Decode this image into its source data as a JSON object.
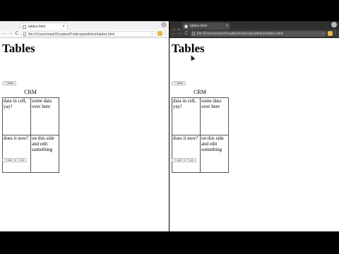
{
  "browsers": [
    {
      "theme": "light",
      "tab_title": "tables.html",
      "url": "file:///Users/mark/Dropbox/Public/gwuttl/test/tables.html",
      "heading": "Tables",
      "table_button_label": "+ table",
      "caption": "CRM",
      "rows": [
        [
          "data in cell, yay!",
          "some data over here"
        ],
        [
          "does it now?",
          "on this side and edit something"
        ]
      ],
      "row_button_label": "+ row",
      "col_button_label": "+ col"
    },
    {
      "theme": "dark",
      "tab_title": "tables.html",
      "url": "file:///Users/mark/Dropbox/Public/gwuttl/test/tables.html",
      "heading": "Tables",
      "table_button_label": "+ table",
      "caption": "CRM",
      "rows": [
        [
          "data in cell, yay!",
          "some data over here"
        ],
        [
          "does it now?",
          "on this side and edit something"
        ]
      ],
      "row_button_label": "+ row",
      "col_button_label": "+ col"
    }
  ],
  "icons": {
    "back": "←",
    "forward": "→",
    "reload": "C",
    "close": "×",
    "star": "☆",
    "menu": "⋮"
  },
  "colors": {
    "light_close": "#fc5c56",
    "light_min": "#fdbc2e",
    "light_max": "#28c840"
  }
}
